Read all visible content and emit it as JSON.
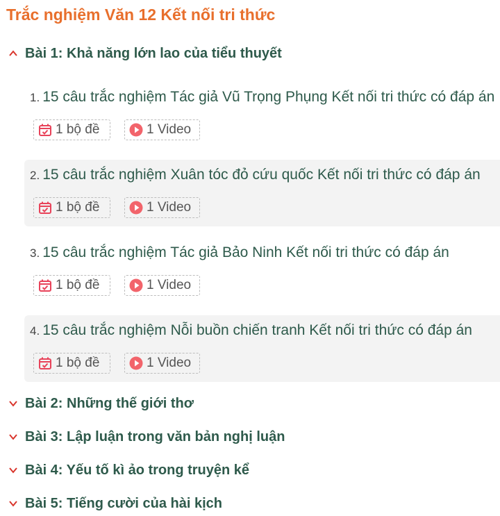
{
  "page_title": "Trắc nghiệm Văn 12 Kết nối tri thức",
  "colors": {
    "title": "#e86f2c",
    "lesson": "#2e5a4b",
    "chevron": "#d9342b",
    "icon": "#e8435a"
  },
  "lessons": [
    {
      "title": "Bài 1: Khả năng lớn lao của tiểu thuyết",
      "expanded": true,
      "items": [
        {
          "num": "1.",
          "title": "15 câu trắc nghiệm Tác giả Vũ Trọng Phụng Kết nối tri thức có đáp án",
          "set_label": "1 bộ đề",
          "video_label": "1 Video"
        },
        {
          "num": "2.",
          "title": "15 câu trắc nghiệm Xuân tóc đỏ cứu quốc Kết nối tri thức có đáp án",
          "set_label": "1 bộ đề",
          "video_label": "1 Video"
        },
        {
          "num": "3.",
          "title": "15 câu trắc nghiệm Tác giả Bảo Ninh Kết nối tri thức có đáp án",
          "set_label": "1 bộ đề",
          "video_label": "1 Video"
        },
        {
          "num": "4.",
          "title": "15 câu trắc nghiệm Nỗi buồn chiến tranh Kết nối tri thức có đáp án",
          "set_label": "1 bộ đề",
          "video_label": "1 Video"
        }
      ]
    },
    {
      "title": "Bài 2: Những thế giới thơ",
      "expanded": false
    },
    {
      "title": "Bài 3: Lập luận trong văn bản nghị luận",
      "expanded": false
    },
    {
      "title": "Bài 4: Yếu tố kì ảo trong truyện kể",
      "expanded": false
    },
    {
      "title": "Bài 5: Tiếng cười của hài kịch",
      "expanded": false
    }
  ]
}
